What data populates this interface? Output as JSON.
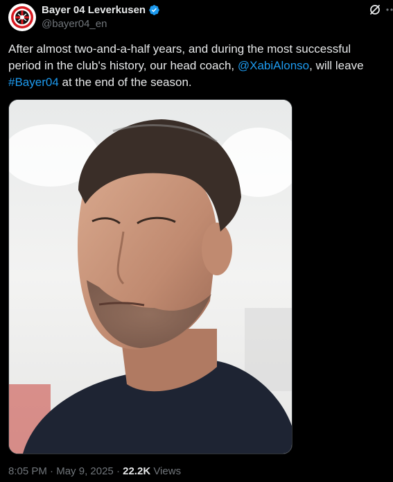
{
  "author": {
    "display_name": "Bayer 04 Leverkusen",
    "handle": "@bayer04_en",
    "avatar_icon": "bayer04-crest-icon",
    "verified": true
  },
  "header_icons": [
    "grok-icon",
    "more-icon"
  ],
  "tweet": {
    "text_part1": "After almost two-and-a-half years, and during the most successful period in the club's history, our head coach, ",
    "mention": "@XabiAlonso",
    "text_part2": ", will leave ",
    "hashtag": "#Bayer04",
    "text_part3": " at the end of the season."
  },
  "footer": {
    "time": "8:05 PM",
    "separator1": " · ",
    "date": "May 9, 2025",
    "separator2": " · ",
    "views_count": "22.2K",
    "views_label": "Views"
  },
  "colors": {
    "background": "#000000",
    "text": "#e7e9ea",
    "muted": "#71767b",
    "link": "#1d9bf0",
    "crest_red": "#d71920"
  }
}
